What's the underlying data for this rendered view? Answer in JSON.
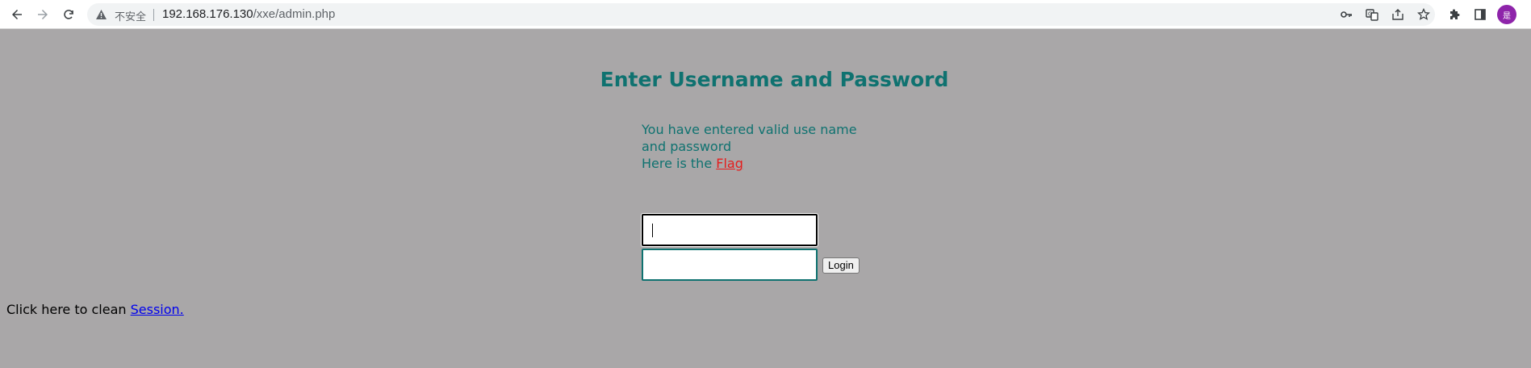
{
  "browser": {
    "security_label": "不安全",
    "url_host": "192.168.176.130",
    "url_path": "/xxe/admin.php",
    "avatar_initial": "是",
    "icons": [
      "back-arrow-icon",
      "forward-arrow-icon",
      "reload-icon",
      "warning-icon",
      "key-icon",
      "translate-icon",
      "share-icon",
      "star-icon",
      "extensions-icon",
      "side-panel-icon"
    ]
  },
  "page": {
    "heading": "Enter Username and Password",
    "message_line1": "You have entered valid use name and password",
    "message_line2_prefix": "Here is the ",
    "flag_link": "Flag",
    "username_value": "",
    "password_value": "",
    "login_button": "Login",
    "session_prefix": "Click here to clean ",
    "session_link": "Session."
  },
  "colors": {
    "page_background": "#a9a7a8",
    "heading": "#0f7270",
    "flag_link": "#e51d1d",
    "session_link": "#0000ee"
  }
}
